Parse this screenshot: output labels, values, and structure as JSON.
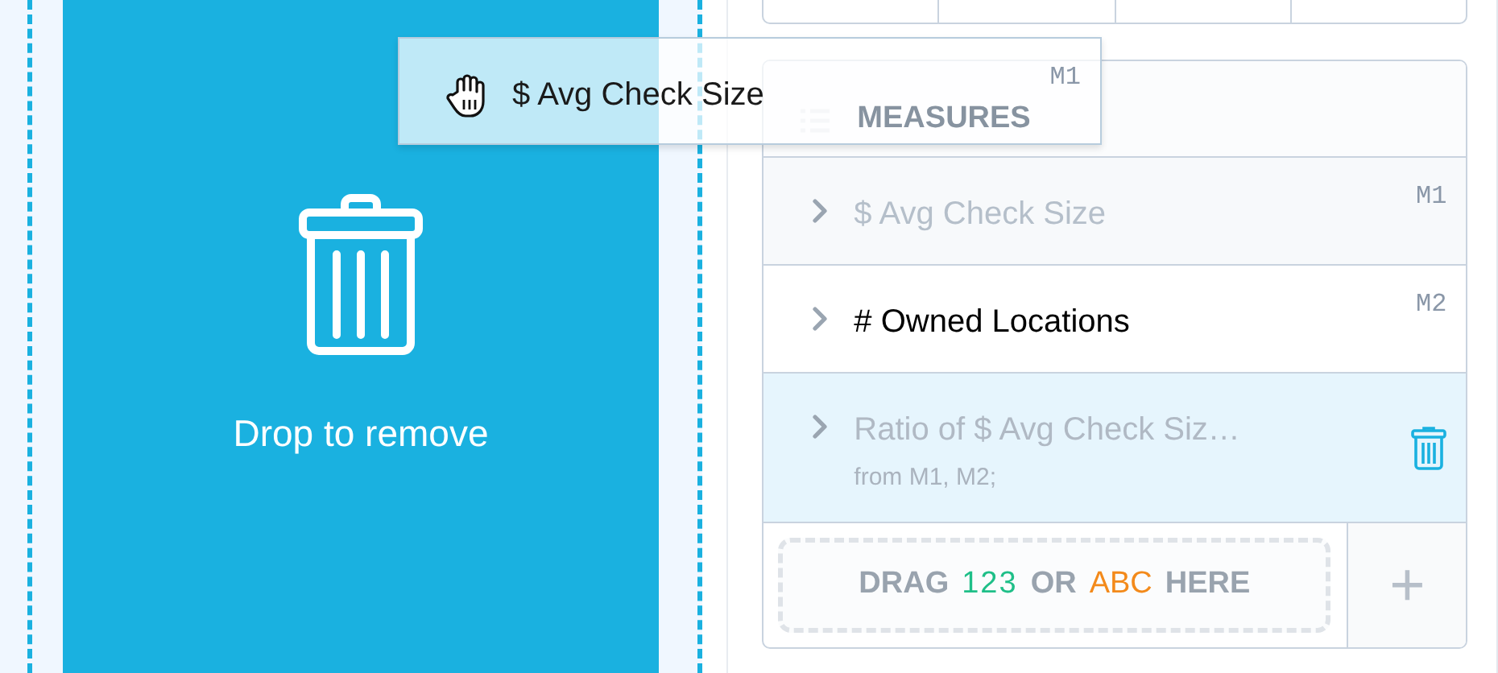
{
  "drop_zone": {
    "label": "Drop to remove"
  },
  "drag_ghost": {
    "title": "$ Avg Check Size",
    "code": "M1"
  },
  "measures": {
    "title": "MEASURES",
    "items": [
      {
        "title": "$ Avg Check Size",
        "code": "M1",
        "dragging": true,
        "hovered": false
      },
      {
        "title": "# Owned Locations",
        "code": "M2",
        "dragging": false,
        "hovered": false
      },
      {
        "title": "Ratio of $ Avg Check Siz…",
        "subtitle": "from M1, M2;",
        "dragging": false,
        "hovered": true
      }
    ],
    "drop_hint": [
      {
        "text": "DRAG",
        "kind": "word"
      },
      {
        "text": "123",
        "kind": "number"
      },
      {
        "text": "OR",
        "kind": "word"
      },
      {
        "text": "ABC",
        "kind": "text"
      },
      {
        "text": "HERE",
        "kind": "word"
      }
    ],
    "add": "+"
  }
}
